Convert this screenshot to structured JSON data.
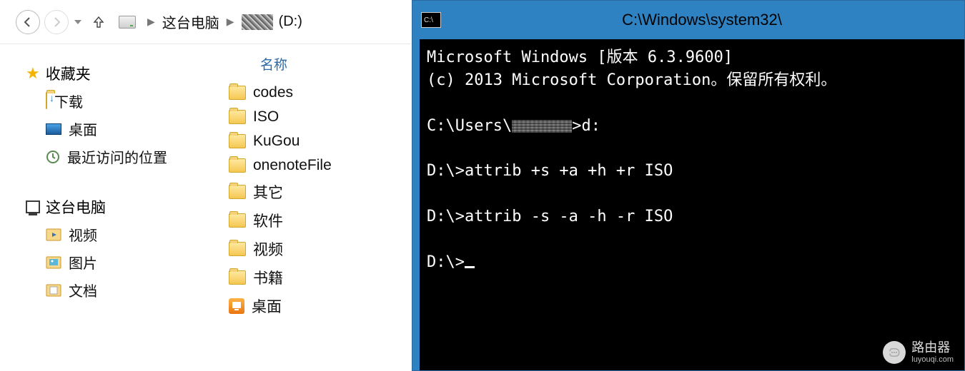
{
  "explorer": {
    "breadcrumb": {
      "root": "这台电脑",
      "drive": "(D:)"
    },
    "column_header": "名称",
    "favorites": {
      "label": "收藏夹",
      "items": [
        {
          "label": "下载",
          "icon": "download"
        },
        {
          "label": "桌面",
          "icon": "desktop"
        },
        {
          "label": "最近访问的位置",
          "icon": "recent"
        }
      ]
    },
    "this_pc_label": "这台电脑",
    "this_pc_items": [
      {
        "label": "视频",
        "icon": "videos"
      },
      {
        "label": "图片",
        "icon": "pictures"
      },
      {
        "label": "文档",
        "icon": "documents"
      }
    ],
    "folders": [
      "codes",
      "ISO",
      "KuGou",
      "onenoteFile",
      "其它",
      "软件",
      "视频",
      "书籍"
    ],
    "desktop_item": "桌面"
  },
  "cmd": {
    "title": "C:\\Windows\\system32\\",
    "lines": {
      "l1": "Microsoft Windows [版本 6.3.9600]",
      "l2": "(c) 2013 Microsoft Corporation。保留所有权利。",
      "l3a": "C:\\Users\\",
      "l3b": ">d:",
      "l4": "D:\\>attrib +s +a +h +r ISO",
      "l5": "D:\\>attrib -s -a -h -r ISO",
      "l6": "D:\\>"
    }
  },
  "watermark": {
    "name": "路由器",
    "domain": "luyouqi.com"
  }
}
